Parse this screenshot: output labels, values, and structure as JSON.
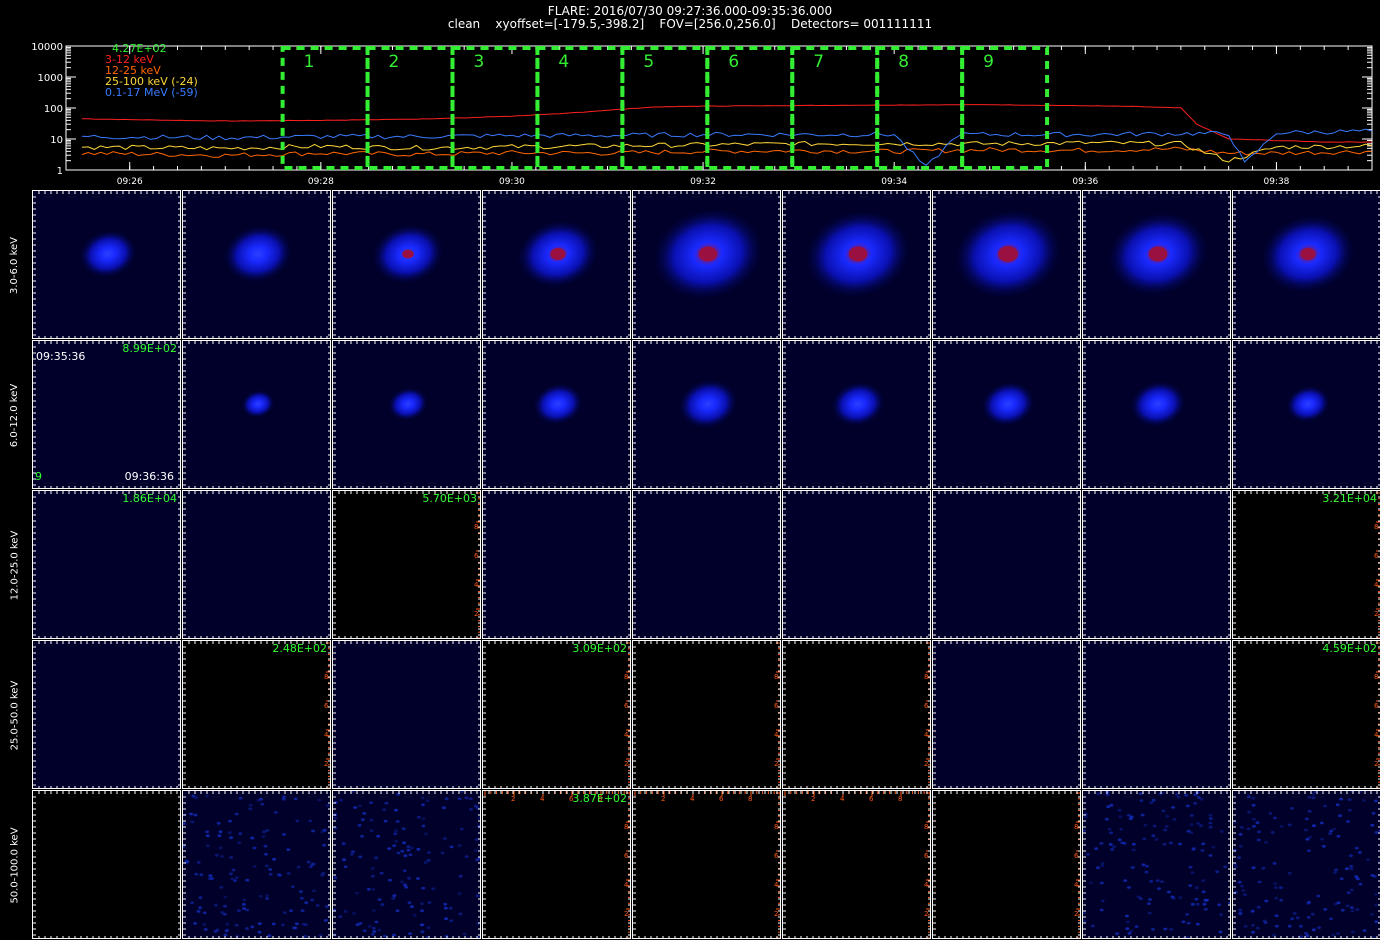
{
  "header": {
    "line1": "FLARE: 2016/07/30 09:27:36.000-09:35:36.000",
    "line2": "clean    xyoffset=[-179.5,-398.2]    FOV=[256.0,256.0]    Detectors= 001111111"
  },
  "chart_data": [
    {
      "type": "line",
      "title": "",
      "y_scale": "log",
      "yticks": [
        "10000",
        "1000",
        "100",
        "10",
        "1"
      ],
      "ylim": [
        1,
        10000
      ],
      "xticks": [
        "09:26",
        "09:28",
        "09:30",
        "09:32",
        "09:34",
        "09:36",
        "09:38"
      ],
      "x_time_range": [
        "09:26",
        "09:38"
      ],
      "legend_placement": "top-left",
      "legend_top": "4.27E+02",
      "series": [
        {
          "name": "3-12 keV",
          "color": "#ff2020",
          "t": [
            "09:25:30",
            "09:26:00",
            "09:27:00",
            "09:28:00",
            "09:29:00",
            "09:29:30",
            "09:30:00",
            "09:30:30",
            "09:31:00",
            "09:31:30",
            "09:32:00",
            "09:33:00",
            "09:34:00",
            "09:35:00",
            "09:36:00",
            "09:36:30",
            "09:37:00",
            "09:37:10",
            "09:37:30",
            "09:38:30",
            "09:39:00"
          ],
          "values": [
            45,
            42,
            38,
            40,
            44,
            48,
            55,
            65,
            85,
            108,
            115,
            120,
            125,
            128,
            118,
            112,
            100,
            30,
            10,
            8,
            8
          ]
        },
        {
          "name": "12-25 keV",
          "color": "#ff6600",
          "t": [
            "09:25:30",
            "09:27:00",
            "09:28:00",
            "09:29:00",
            "09:30:00",
            "09:31:00",
            "09:32:00",
            "09:33:00",
            "09:34:00",
            "09:35:00",
            "09:36:00",
            "09:37:00",
            "09:37:30",
            "09:38:00",
            "09:39:00"
          ],
          "values": [
            3.5,
            3.0,
            3.5,
            3.2,
            3.6,
            3.5,
            4.0,
            4.2,
            4.0,
            4.5,
            4.3,
            4.8,
            3.5,
            3.5,
            4.0
          ]
        },
        {
          "name": "25-100 keV (-24)",
          "color": "#ffd83a",
          "t": [
            "09:25:30",
            "09:27:00",
            "09:28:00",
            "09:29:00",
            "09:30:00",
            "09:31:00",
            "09:32:00",
            "09:33:00",
            "09:34:00",
            "09:35:00",
            "09:36:00",
            "09:37:00",
            "09:37:30",
            "09:38:00",
            "09:39:00"
          ],
          "values": [
            5.5,
            5.0,
            5.8,
            5.2,
            5.6,
            6.0,
            6.5,
            7.0,
            7.2,
            7.0,
            7.5,
            7.0,
            2.0,
            5.5,
            6.0
          ]
        },
        {
          "name": "0.1-17 MeV (-59)",
          "color": "#3a7bff",
          "t": [
            "09:25:30",
            "09:27:00",
            "09:28:00",
            "09:29:00",
            "09:30:00",
            "09:31:00",
            "09:32:00",
            "09:33:00",
            "09:34:00",
            "09:34:20",
            "09:34:40",
            "09:35:00",
            "09:36:00",
            "09:37:00",
            "09:37:30",
            "09:37:40",
            "09:38:00",
            "09:39:00"
          ],
          "values": [
            12,
            11,
            12,
            12,
            13,
            13,
            14,
            14,
            14,
            1.2,
            14,
            14,
            14,
            15,
            15,
            1.6,
            16,
            18
          ]
        }
      ],
      "intervals": [
        "1",
        "2",
        "3",
        "4",
        "5",
        "6",
        "7",
        "8",
        "9"
      ],
      "interval_start": "09:27:36",
      "interval_end": "09:35:36",
      "interval_color": "#33ee33"
    },
    {
      "type": "heatmap",
      "row_labels": [
        "3.0-6.0 keV",
        "6.0-12.0 keV",
        "12.0-25.0 keV",
        "25.0-50.0 keV",
        "50.0-100.0 keV"
      ],
      "columns": 9,
      "cells": [
        [
          {
            "k": "src",
            "s": 0.3,
            "r": 0
          },
          {
            "k": "src",
            "s": 0.42,
            "r": 0
          },
          {
            "k": "src",
            "s": 0.45,
            "r": 0.3
          },
          {
            "k": "src",
            "s": 0.55,
            "r": 0.6
          },
          {
            "k": "src",
            "s": 0.85,
            "r": 0.9
          },
          {
            "k": "src",
            "s": 0.8,
            "r": 0.9
          },
          {
            "k": "src",
            "s": 0.82,
            "r": 1.0
          },
          {
            "k": "src",
            "s": 0.75,
            "r": 0.9
          },
          {
            "k": "src",
            "s": 0.68,
            "r": 0.6
          }
        ],
        [
          {
            "k": "faint",
            "s": 0
          },
          {
            "k": "src",
            "s": 0.05,
            "r": 0
          },
          {
            "k": "src",
            "s": 0.12,
            "r": 0
          },
          {
            "k": "src",
            "s": 0.22,
            "r": 0
          },
          {
            "k": "src",
            "s": 0.32,
            "r": 0
          },
          {
            "k": "src",
            "s": 0.26,
            "r": 0
          },
          {
            "k": "src",
            "s": 0.26,
            "r": 0
          },
          {
            "k": "src",
            "s": 0.28,
            "r": 0
          },
          {
            "k": "src",
            "s": 0.16,
            "r": 0
          }
        ],
        [
          {
            "k": "faint"
          },
          {
            "k": "faint"
          },
          {
            "k": "black"
          },
          {
            "k": "faint"
          },
          {
            "k": "faint"
          },
          {
            "k": "faint"
          },
          {
            "k": "faint"
          },
          {
            "k": "faint"
          },
          {
            "k": "black"
          }
        ],
        [
          {
            "k": "faint"
          },
          {
            "k": "black"
          },
          {
            "k": "faint"
          },
          {
            "k": "black"
          },
          {
            "k": "black"
          },
          {
            "k": "black"
          },
          {
            "k": "faint"
          },
          {
            "k": "faint"
          },
          {
            "k": "black"
          }
        ],
        [
          {
            "k": "black"
          },
          {
            "k": "noise"
          },
          {
            "k": "noise"
          },
          {
            "k": "black"
          },
          {
            "k": "black"
          },
          {
            "k": "black"
          },
          {
            "k": "black"
          },
          {
            "k": "noise"
          },
          {
            "k": "noise"
          }
        ]
      ],
      "peak_labels": {
        "r1c0": "8.99E+02",
        "r2c0": "1.86E+04",
        "r2c2": "5.70E+03",
        "r2c8": "3.21E+04",
        "r3c1": "2.48E+02",
        "r3c3": "3.09E+02",
        "r3c8": "4.59E+02",
        "r4c3": "3.87E+02"
      },
      "time_labels": {
        "start": "09:35:36",
        "end": "09:36:36",
        "detector": "9"
      }
    }
  ]
}
